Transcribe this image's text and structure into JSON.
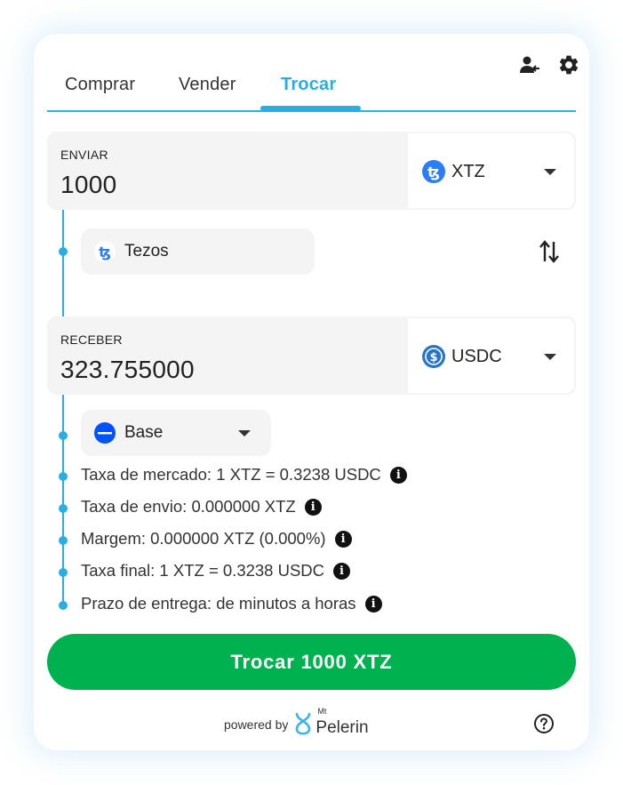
{
  "header": {
    "icons": [
      "user-switch-icon",
      "gear-icon"
    ]
  },
  "tabs": [
    {
      "label": "Comprar",
      "active": false
    },
    {
      "label": "Vender",
      "active": false
    },
    {
      "label": "Trocar",
      "active": true
    }
  ],
  "send": {
    "label": "ENVIAR",
    "amount": "1000",
    "currency": "XTZ",
    "network": "Tezos"
  },
  "receive": {
    "label": "RECEBER",
    "amount": "323.755000",
    "currency": "USDC",
    "network": "Base"
  },
  "info": [
    "Taxa de mercado: 1 XTZ = 0.3238 USDC",
    "Taxa de envio: 0.000000 XTZ",
    "Margem: 0.000000 XTZ (0.000%)",
    "Taxa final: 1 XTZ = 0.3238 USDC",
    "Prazo de entrega: de minutos a horas"
  ],
  "cta": {
    "label": "Trocar 1000 XTZ"
  },
  "footer": {
    "powered_by": "powered by",
    "brand_mt": "Mt",
    "brand_name": "Pelerin"
  },
  "colors": {
    "accent": "#29aee3",
    "cta": "#00b14f",
    "xtz": "#2c7df7",
    "usdc": "#2775ca",
    "base": "#0052ff"
  }
}
